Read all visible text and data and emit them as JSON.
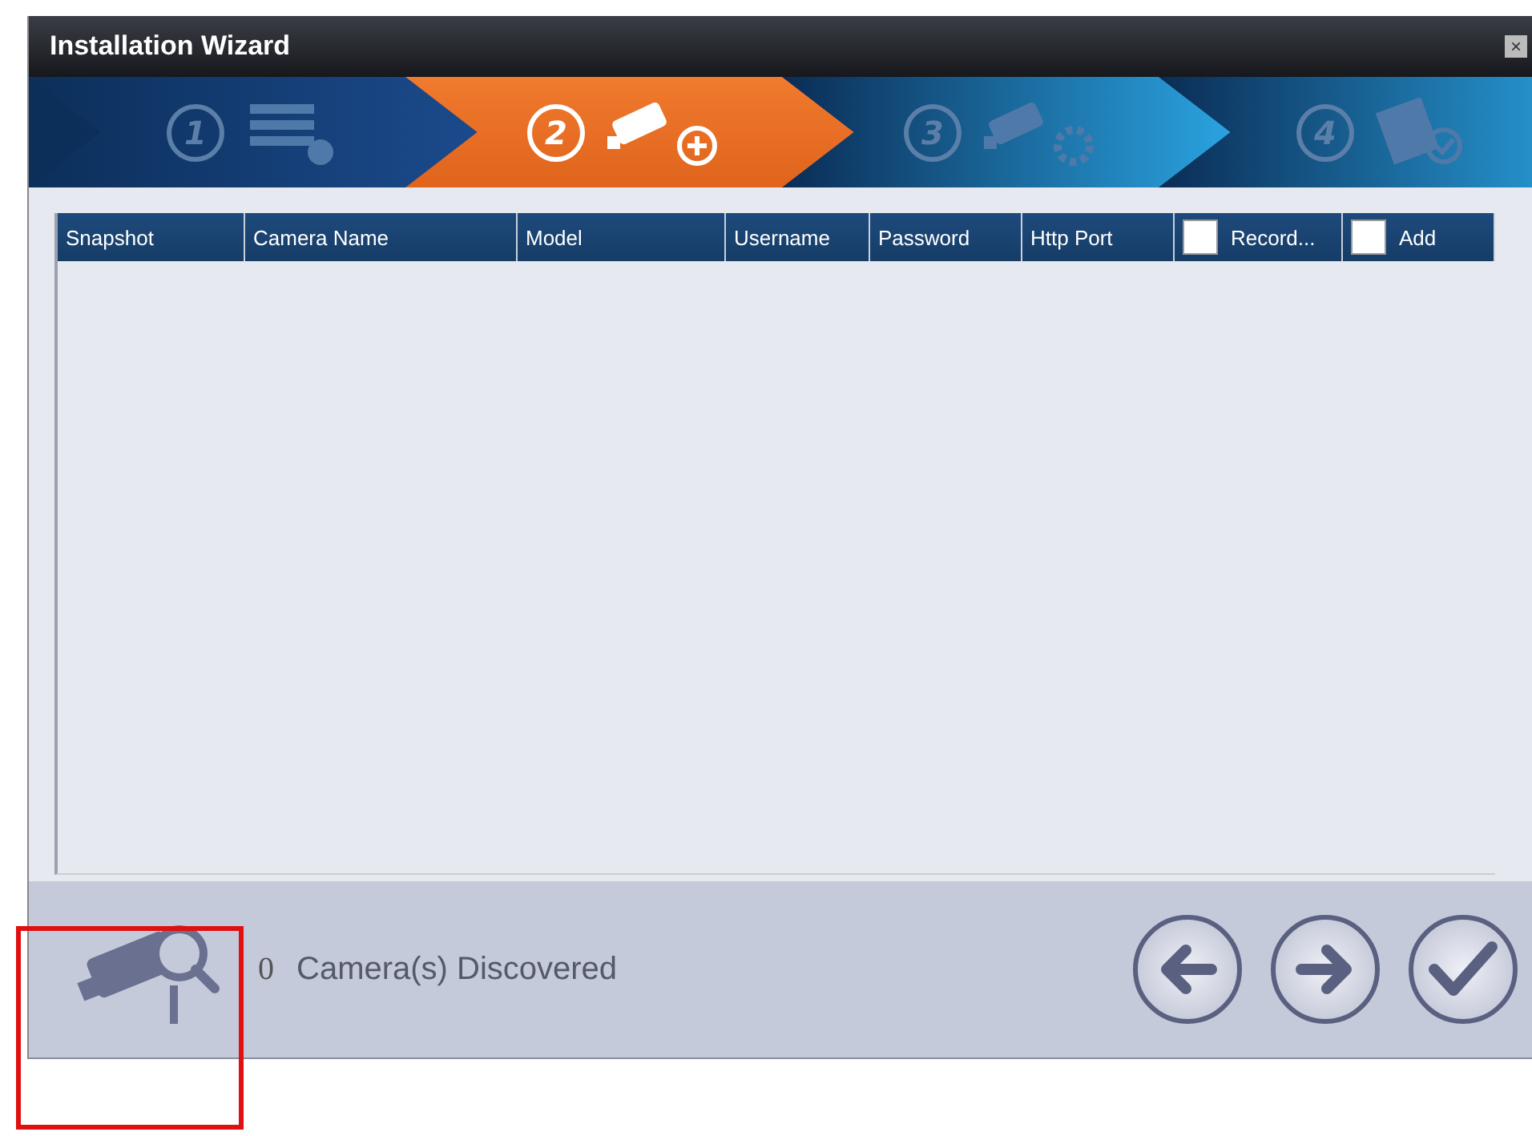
{
  "window": {
    "title": "Installation Wizard",
    "close": "×"
  },
  "steps": [
    {
      "number": "1",
      "kind": "list",
      "selected": false
    },
    {
      "number": "2",
      "kind": "camera-add",
      "selected": true
    },
    {
      "number": "3",
      "kind": "camera-gear",
      "selected": false
    },
    {
      "number": "4",
      "kind": "checklist",
      "selected": false
    }
  ],
  "table": {
    "columns": [
      {
        "label": "Snapshot"
      },
      {
        "label": "Camera Name"
      },
      {
        "label": "Model"
      },
      {
        "label": "Username"
      },
      {
        "label": "Password"
      },
      {
        "label": "Http Port"
      },
      {
        "label": "Record...",
        "kind": "checkbox",
        "checked": false
      },
      {
        "label": "Add",
        "kind": "checkbox",
        "checked": false
      }
    ]
  },
  "footer": {
    "count": "0",
    "label": "Camera(s) Discovered",
    "buttons": [
      {
        "kind": "back"
      },
      {
        "kind": "next"
      },
      {
        "kind": "finish"
      }
    ]
  }
}
